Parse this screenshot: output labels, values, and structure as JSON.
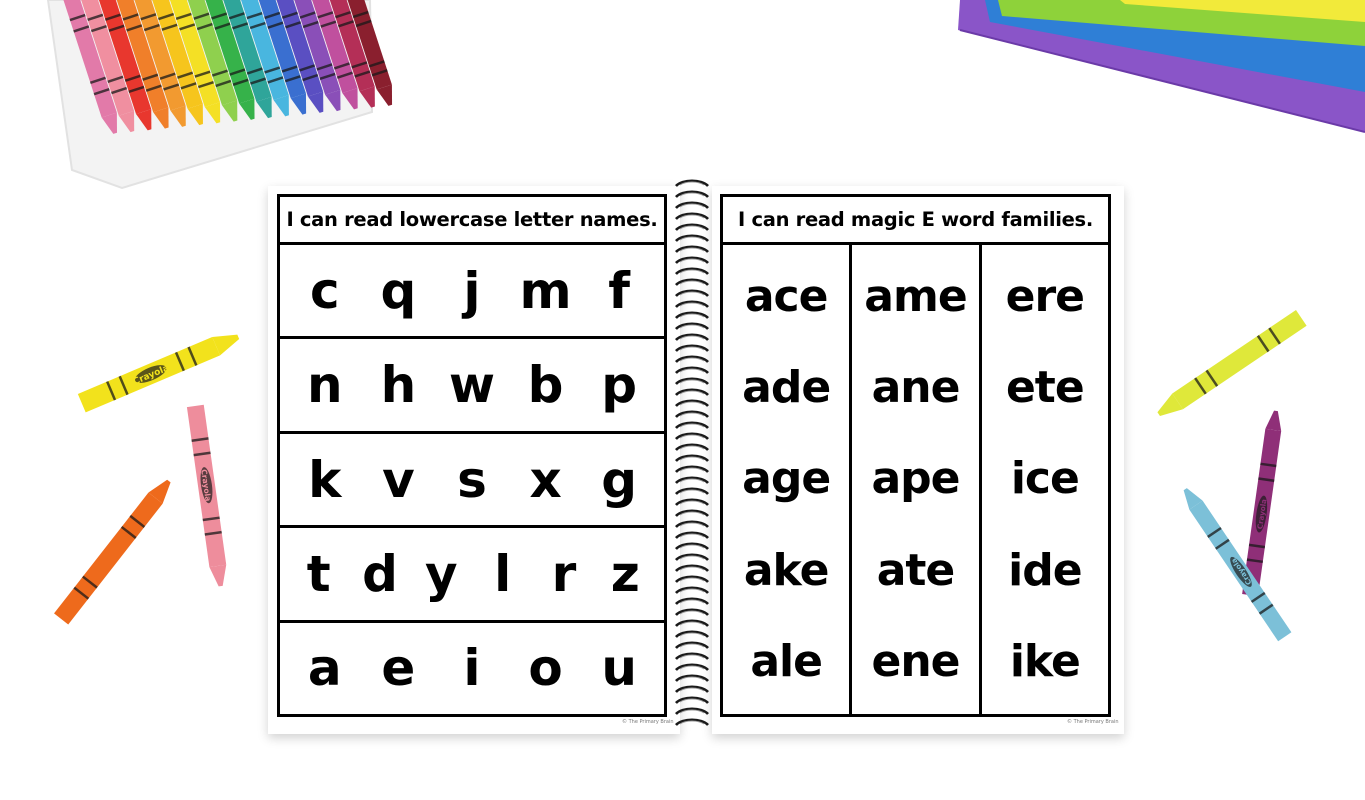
{
  "left_page": {
    "title": "I can read lowercase letter names.",
    "rows": [
      [
        "c",
        "q",
        "j",
        "m",
        "f"
      ],
      [
        "n",
        "h",
        "w",
        "b",
        "p"
      ],
      [
        "k",
        "v",
        "s",
        "x",
        "g"
      ],
      [
        "t",
        "d",
        "y",
        "l",
        "r",
        "z"
      ],
      [
        "a",
        "e",
        "i",
        "o",
        "u"
      ]
    ],
    "credit": "© The Primary Brain"
  },
  "right_page": {
    "title": "I can read magic E word families.",
    "columns": [
      [
        "ace",
        "ade",
        "age",
        "ake",
        "ale"
      ],
      [
        "ame",
        "ane",
        "ape",
        "ate",
        "ene"
      ],
      [
        "ere",
        "ete",
        "ice",
        "ide",
        "ike"
      ]
    ],
    "credit": "© The Primary Brain"
  },
  "crayon_brand": "Crayola",
  "colors": {
    "background": "#ffffff",
    "ink": "#000000",
    "crayon_yellow": "#f2e21c",
    "crayon_orange": "#ee6a1c",
    "crayon_pink": "#ee8d9c",
    "crayon_yellowgreen": "#dfe83a",
    "crayon_purple": "#8f2f78",
    "crayon_blue": "#7cc0d8",
    "folder_purple": "#8a55c8",
    "folder_blue": "#2f7fd6",
    "folder_green": "#8ed23a",
    "folder_yellow": "#f2ea3a"
  }
}
